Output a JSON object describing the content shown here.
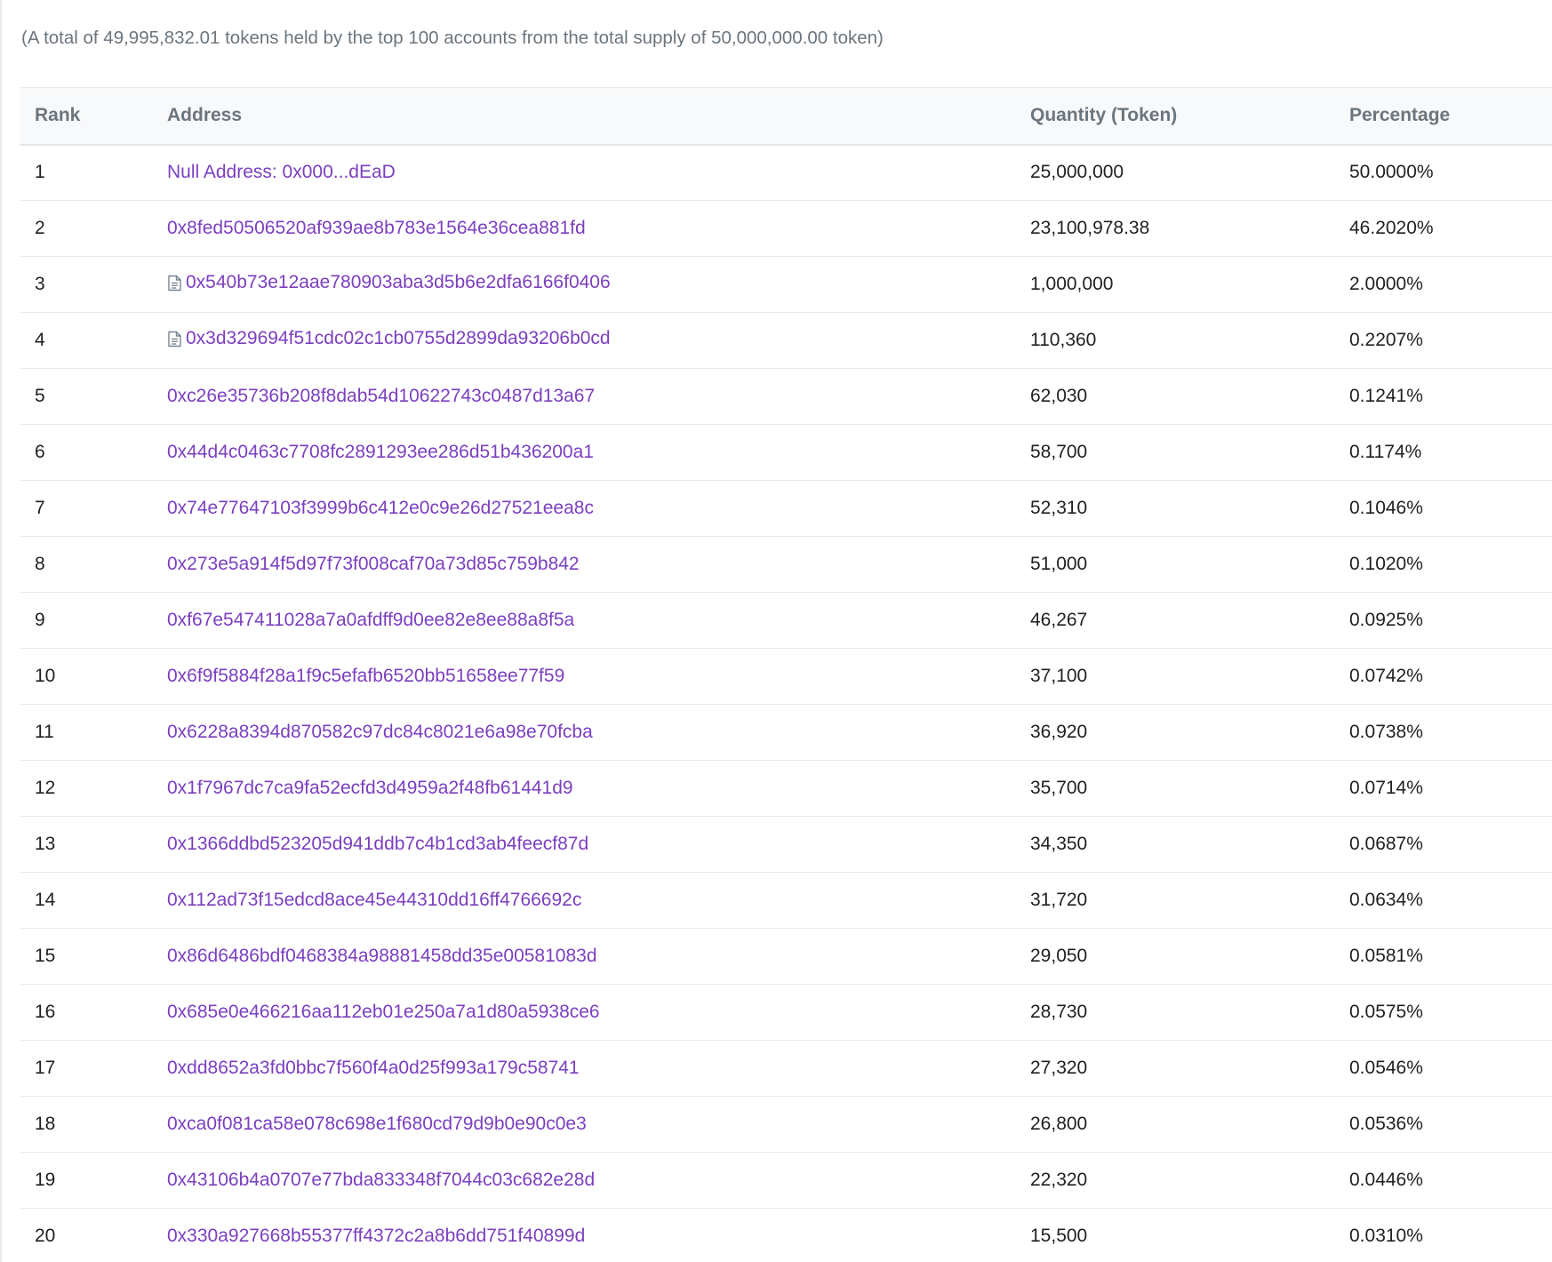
{
  "summary_text": "(A total of 49,995,832.01 tokens held by the top 100 accounts from the total supply of 50,000,000.00 token)",
  "table": {
    "headers": {
      "rank": "Rank",
      "address": "Address",
      "quantity": "Quantity (Token)",
      "percentage": "Percentage"
    },
    "rows": [
      {
        "rank": "1",
        "address": "Null Address: 0x000...dEaD",
        "contract": false,
        "quantity": "25,000,000",
        "percentage": "50.0000%"
      },
      {
        "rank": "2",
        "address": "0x8fed50506520af939ae8b783e1564e36cea881fd",
        "contract": false,
        "quantity": "23,100,978.38",
        "percentage": "46.2020%"
      },
      {
        "rank": "3",
        "address": "0x540b73e12aae780903aba3d5b6e2dfa6166f0406",
        "contract": true,
        "quantity": "1,000,000",
        "percentage": "2.0000%"
      },
      {
        "rank": "4",
        "address": "0x3d329694f51cdc02c1cb0755d2899da93206b0cd",
        "contract": true,
        "quantity": "110,360",
        "percentage": "0.2207%"
      },
      {
        "rank": "5",
        "address": "0xc26e35736b208f8dab54d10622743c0487d13a67",
        "contract": false,
        "quantity": "62,030",
        "percentage": "0.1241%"
      },
      {
        "rank": "6",
        "address": "0x44d4c0463c7708fc2891293ee286d51b436200a1",
        "contract": false,
        "quantity": "58,700",
        "percentage": "0.1174%"
      },
      {
        "rank": "7",
        "address": "0x74e77647103f3999b6c412e0c9e26d27521eea8c",
        "contract": false,
        "quantity": "52,310",
        "percentage": "0.1046%"
      },
      {
        "rank": "8",
        "address": "0x273e5a914f5d97f73f008caf70a73d85c759b842",
        "contract": false,
        "quantity": "51,000",
        "percentage": "0.1020%"
      },
      {
        "rank": "9",
        "address": "0xf67e547411028a7a0afdff9d0ee82e8ee88a8f5a",
        "contract": false,
        "quantity": "46,267",
        "percentage": "0.0925%"
      },
      {
        "rank": "10",
        "address": "0x6f9f5884f28a1f9c5efafb6520bb51658ee77f59",
        "contract": false,
        "quantity": "37,100",
        "percentage": "0.0742%"
      },
      {
        "rank": "11",
        "address": "0x6228a8394d870582c97dc84c8021e6a98e70fcba",
        "contract": false,
        "quantity": "36,920",
        "percentage": "0.0738%"
      },
      {
        "rank": "12",
        "address": "0x1f7967dc7ca9fa52ecfd3d4959a2f48fb61441d9",
        "contract": false,
        "quantity": "35,700",
        "percentage": "0.0714%"
      },
      {
        "rank": "13",
        "address": "0x1366ddbd523205d941ddb7c4b1cd3ab4feecf87d",
        "contract": false,
        "quantity": "34,350",
        "percentage": "0.0687%"
      },
      {
        "rank": "14",
        "address": "0x112ad73f15edcd8ace45e44310dd16ff4766692c",
        "contract": false,
        "quantity": "31,720",
        "percentage": "0.0634%"
      },
      {
        "rank": "15",
        "address": "0x86d6486bdf0468384a98881458dd35e00581083d",
        "contract": false,
        "quantity": "29,050",
        "percentage": "0.0581%"
      },
      {
        "rank": "16",
        "address": "0x685e0e466216aa112eb01e250a7a1d80a5938ce6",
        "contract": false,
        "quantity": "28,730",
        "percentage": "0.0575%"
      },
      {
        "rank": "17",
        "address": "0xdd8652a3fd0bbc7f560f4a0d25f993a179c58741",
        "contract": false,
        "quantity": "27,320",
        "percentage": "0.0546%"
      },
      {
        "rank": "18",
        "address": "0xca0f081ca58e078c698e1f680cd79d9b0e90c0e3",
        "contract": false,
        "quantity": "26,800",
        "percentage": "0.0536%"
      },
      {
        "rank": "19",
        "address": "0x43106b4a0707e77bda833348f7044c03c682e28d",
        "contract": false,
        "quantity": "22,320",
        "percentage": "0.0446%"
      },
      {
        "rank": "20",
        "address": "0x330a927668b55377ff4372c2a8b6dd751f40899d",
        "contract": false,
        "quantity": "15,500",
        "percentage": "0.0310%"
      }
    ]
  },
  "colors": {
    "link": "#7b3fbf",
    "text": "#1e2022",
    "muted": "#6c757d",
    "header_bg": "#f8f9fa",
    "row_border": "#e7eaf3"
  },
  "icons": {
    "contract": "file-text-icon"
  }
}
